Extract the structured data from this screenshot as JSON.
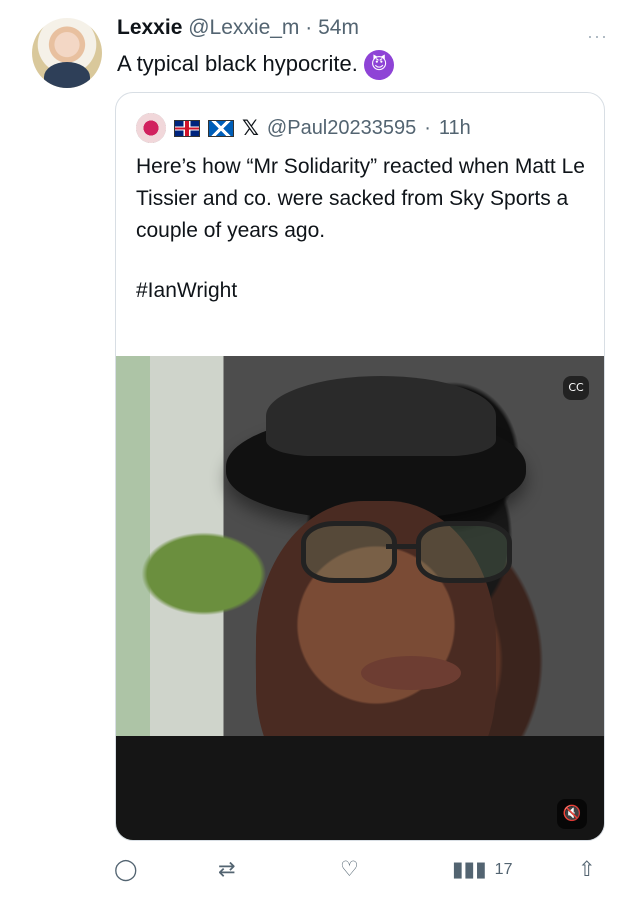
{
  "post": {
    "name": "Lexxie",
    "handle": "@Lexxie_m",
    "dot": " · ",
    "time": "54m",
    "text": "A typical black hypocrite.",
    "more": "···"
  },
  "quote": {
    "handle": "@Paul20233595",
    "dot": " · ",
    "time": "11h",
    "text": "Here’s how “Mr Solidarity” reacted when Matt Le Tissier and co. were sacked from Sky Sports a couple of years ago.",
    "hashtag": "#IanWright"
  },
  "video": {
    "cc_label": "CC",
    "mute_label": "🔇"
  },
  "actions": {
    "reply": "◯",
    "retweet": "⇄",
    "like": "♡",
    "views_icon": "▮▮▮",
    "views_count": "17",
    "share": "⇧"
  }
}
